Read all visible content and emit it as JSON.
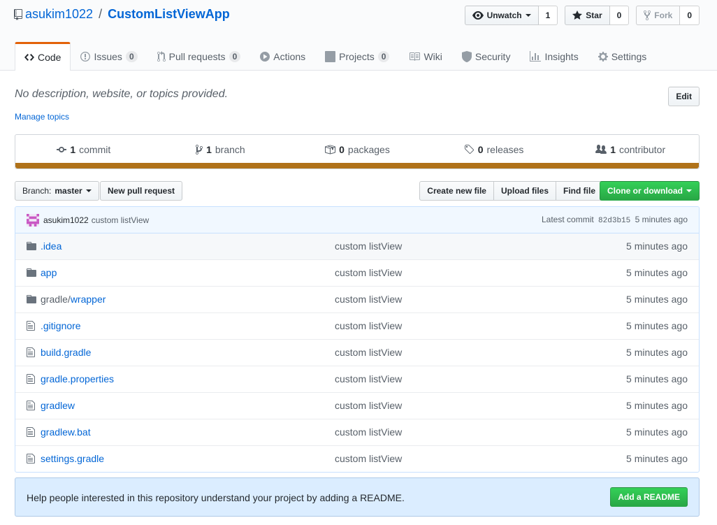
{
  "repo": {
    "owner": "asukim1022",
    "separator": "/",
    "name": "CustomListViewApp"
  },
  "actions": {
    "watch": {
      "label": "Unwatch",
      "count": "1"
    },
    "star": {
      "label": "Star",
      "count": "0"
    },
    "fork": {
      "label": "Fork",
      "count": "0"
    }
  },
  "nav": [
    {
      "label": "Code",
      "icon": "code-icon",
      "selected": true
    },
    {
      "label": "Issues",
      "count": "0",
      "icon": "issue-icon"
    },
    {
      "label": "Pull requests",
      "count": "0",
      "icon": "pull-request-icon"
    },
    {
      "label": "Actions",
      "icon": "play-icon"
    },
    {
      "label": "Projects",
      "count": "0",
      "icon": "project-icon"
    },
    {
      "label": "Wiki",
      "icon": "book-icon"
    },
    {
      "label": "Security",
      "icon": "shield-icon"
    },
    {
      "label": "Insights",
      "icon": "graph-icon"
    },
    {
      "label": "Settings",
      "icon": "gear-icon"
    }
  ],
  "description": "No description, website, or topics provided.",
  "edit_label": "Edit",
  "manage_topics": "Manage topics",
  "summary": {
    "commits": {
      "num": "1",
      "label": "commit"
    },
    "branches": {
      "num": "1",
      "label": "branch"
    },
    "packages": {
      "num": "0",
      "label": "packages"
    },
    "releases": {
      "num": "0",
      "label": "releases"
    },
    "contributors": {
      "num": "1",
      "label": "contributor"
    }
  },
  "language_color": "#b07219",
  "file_nav": {
    "branch_prefix": "Branch:",
    "branch": "master",
    "new_pr": "New pull request",
    "create_file": "Create new file",
    "upload_files": "Upload files",
    "find_file": "Find file",
    "clone": "Clone or download"
  },
  "commit": {
    "author": "asukim1022",
    "message": "custom listView",
    "latest_label": "Latest commit",
    "sha": "82d3b15",
    "age": "5 minutes ago"
  },
  "files": [
    {
      "type": "dir",
      "name": ".idea",
      "message": "custom listView",
      "age": "5 minutes ago"
    },
    {
      "type": "dir",
      "name": "app",
      "message": "custom listView",
      "age": "5 minutes ago"
    },
    {
      "type": "dir",
      "name_prefix": "gradle/",
      "name": "wrapper",
      "message": "custom listView",
      "age": "5 minutes ago"
    },
    {
      "type": "file",
      "name": ".gitignore",
      "message": "custom listView",
      "age": "5 minutes ago"
    },
    {
      "type": "file",
      "name": "build.gradle",
      "message": "custom listView",
      "age": "5 minutes ago"
    },
    {
      "type": "file",
      "name": "gradle.properties",
      "message": "custom listView",
      "age": "5 minutes ago"
    },
    {
      "type": "file",
      "name": "gradlew",
      "message": "custom listView",
      "age": "5 minutes ago"
    },
    {
      "type": "file",
      "name": "gradlew.bat",
      "message": "custom listView",
      "age": "5 minutes ago"
    },
    {
      "type": "file",
      "name": "settings.gradle",
      "message": "custom listView",
      "age": "5 minutes ago"
    }
  ],
  "readme": {
    "text": "Help people interested in this repository understand your project by adding a README.",
    "button": "Add a README"
  }
}
